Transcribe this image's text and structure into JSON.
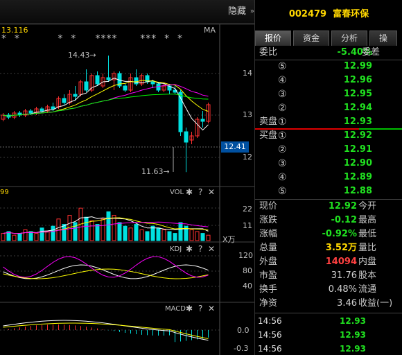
{
  "header": {
    "hide_label": "隐藏",
    "price_label": "13.116",
    "ma_label": "MA"
  },
  "main_chart": {
    "stars": "*  *          *  *     ****      ***  *  *",
    "axis": [
      "14",
      "13",
      "12"
    ],
    "high_annot": "14.43→",
    "low_annot": "11.63→",
    "current_price": "12.41"
  },
  "vol_panel": {
    "title": "VOL",
    "left_value": "99",
    "axis": [
      "22",
      "11"
    ],
    "unit": "X万"
  },
  "kdj_panel": {
    "title": "KDJ",
    "axis": [
      "120",
      "80",
      "40"
    ]
  },
  "macd_panel": {
    "title": "MACD",
    "axis": [
      "0.0",
      "-0.3"
    ]
  },
  "stock": {
    "code": "002479",
    "name": "富春环保"
  },
  "tabs": [
    {
      "label": "报价",
      "active": true
    },
    {
      "label": "资金",
      "active": false
    },
    {
      "label": "分析",
      "active": false
    },
    {
      "label": "操",
      "active": false
    }
  ],
  "weibi": {
    "label": "委比",
    "value": "-5.40%",
    "label2": "委差"
  },
  "sell_orders": [
    {
      "idx": "⑤",
      "price": "12.99"
    },
    {
      "idx": "④",
      "price": "12.96"
    },
    {
      "idx": "③",
      "price": "12.95"
    },
    {
      "idx": "②",
      "price": "12.94"
    },
    {
      "label": "卖盘",
      "idx": "①",
      "price": "12.93"
    }
  ],
  "buy_orders": [
    {
      "label": "买盘",
      "idx": "①",
      "price": "12.92"
    },
    {
      "idx": "②",
      "price": "12.91"
    },
    {
      "idx": "③",
      "price": "12.90"
    },
    {
      "idx": "④",
      "price": "12.89"
    },
    {
      "idx": "⑤",
      "price": "12.88"
    }
  ],
  "info": [
    {
      "label": "现价",
      "value": "12.92",
      "label2": "今开",
      "color": "#20e020"
    },
    {
      "label": "涨跌",
      "value": "-0.12",
      "label2": "最高",
      "color": "#20e020"
    },
    {
      "label": "涨幅",
      "value": "-0.92%",
      "label2": "最低",
      "color": "#20e020"
    },
    {
      "label": "总量",
      "value": "3.52万",
      "label2": "量比",
      "color": "#ffd700"
    },
    {
      "label": "外盘",
      "value": "14094",
      "label2": "内盘",
      "color": "#ff4040"
    },
    {
      "label": "市盈",
      "value": "31.76",
      "label2": "股本",
      "color": "#d0d0d0"
    },
    {
      "label": "换手",
      "value": "0.48%",
      "label2": "流通",
      "color": "#d0d0d0"
    },
    {
      "label": "净资",
      "value": "3.46",
      "label2": "收益(一)",
      "color": "#d0d0d0"
    }
  ],
  "ticks": [
    {
      "time": "14:56",
      "price": "12.93"
    },
    {
      "time": "14:56",
      "price": "12.93"
    },
    {
      "time": "14:56",
      "price": "12.93"
    }
  ]
}
